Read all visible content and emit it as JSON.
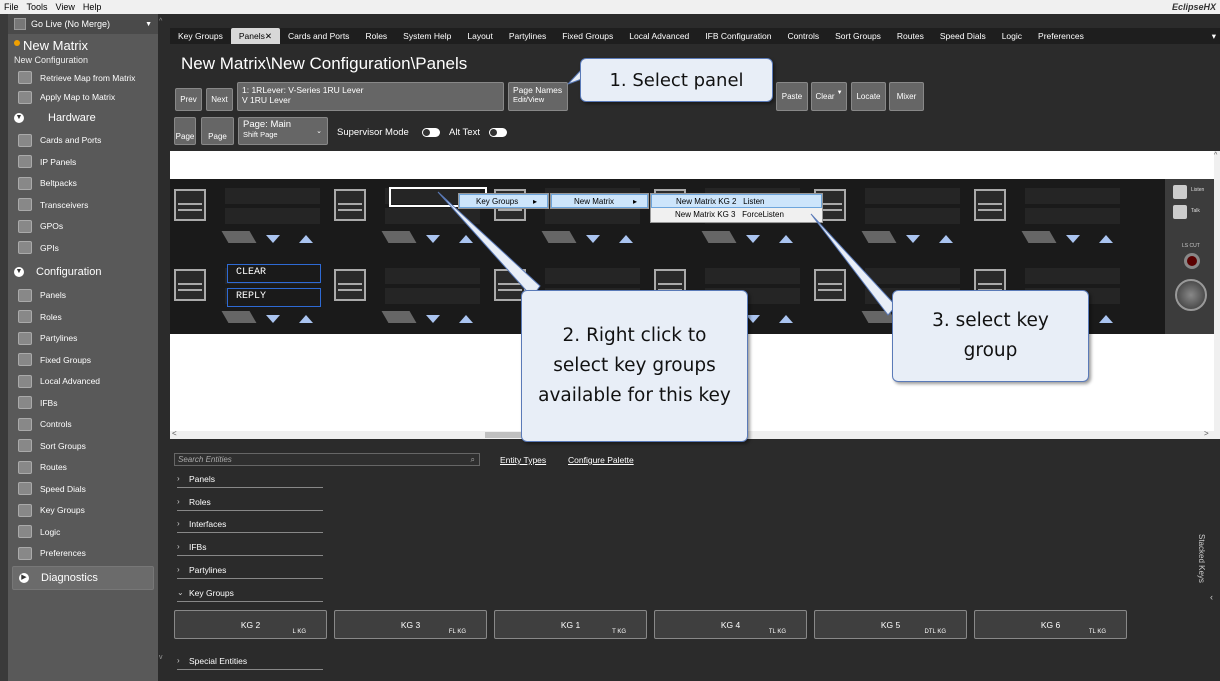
{
  "menubar": {
    "items": [
      "File",
      "Tools",
      "View",
      "Help"
    ],
    "brand": "EclipseHX"
  },
  "sidebar": {
    "go_live": "Go Live (No Merge)",
    "project_title": "New Matrix",
    "project_sub": "New Configuration",
    "top_items": [
      "Retrieve Map from Matrix",
      "Apply Map to Matrix"
    ],
    "hardware_label": "Hardware",
    "hardware_items": [
      "Cards and Ports",
      "IP Panels",
      "Beltpacks",
      "Transceivers",
      "GPOs",
      "GPIs"
    ],
    "configuration_label": "Configuration",
    "configuration_items": [
      "Panels",
      "Roles",
      "Partylines",
      "Fixed Groups",
      "Local Advanced",
      "IFBs",
      "Controls",
      "Sort Groups",
      "Routes",
      "Speed Dials",
      "Key Groups",
      "Logic",
      "Preferences"
    ],
    "diagnostics_label": "Diagnostics"
  },
  "tabs": [
    "Key Groups",
    "Panels",
    "Cards and Ports",
    "Roles",
    "System Help",
    "Layout",
    "Partylines",
    "Fixed Groups",
    "Local Advanced",
    "IFB Configuration",
    "Controls",
    "Sort Groups",
    "Routes",
    "Speed Dials",
    "Logic",
    "Preferences"
  ],
  "tab_close": "✕",
  "active_tab": "Panels",
  "page_title": "New Matrix\\New Configuration\\Panels",
  "toolbar": {
    "prev": "Prev",
    "next": "Next",
    "panel_select_l1": "1: 1RLever: V-Series 1RU Lever",
    "panel_select_l2": "V 1RU Lever",
    "page_names_l1": "Page Names",
    "page_names_l2": "Edit/View",
    "paste": "Paste",
    "clear": "Clear",
    "locate": "Locate",
    "mixer": "Mixer",
    "page_btn1": "Page",
    "page_btn2": "Page",
    "page_select_l1": "Page: Main",
    "page_select_l2": "Shift Page",
    "supervisor_mode": "Supervisor Mode",
    "alt_text": "Alt Text"
  },
  "panel_keys": {
    "clear": "CLEAR",
    "reply": "REPLY",
    "listen": "Listen",
    "talk": "Talk",
    "ls_cut": "LS CUT"
  },
  "context_menu": {
    "level1": "Key Groups",
    "level2": "New Matrix",
    "level3": [
      "New Matrix KG 2   Listen",
      "New Matrix KG 3   ForceListen"
    ]
  },
  "callouts": {
    "c1": "1. Select panel",
    "c2": "2. Right click to select key groups available for this key",
    "c3": "3. select key group"
  },
  "bottom": {
    "search_placeholder": "Search Entities",
    "entity_types": "Entity Types",
    "configure_palette": "Configure Palette",
    "entities": [
      "Panels",
      "Roles",
      "Interfaces",
      "IFBs",
      "Partylines",
      "Key Groups",
      "Special Entities"
    ],
    "key_groups": [
      {
        "name": "KG 2",
        "type": "L KG"
      },
      {
        "name": "KG 3",
        "type": "FL KG"
      },
      {
        "name": "KG 1",
        "type": "T KG"
      },
      {
        "name": "KG 4",
        "type": "TL KG"
      },
      {
        "name": "KG 5",
        "type": "DTL KG"
      },
      {
        "name": "KG 6",
        "type": "TL KG"
      }
    ],
    "stacked_keys": "Stacked Keys"
  }
}
